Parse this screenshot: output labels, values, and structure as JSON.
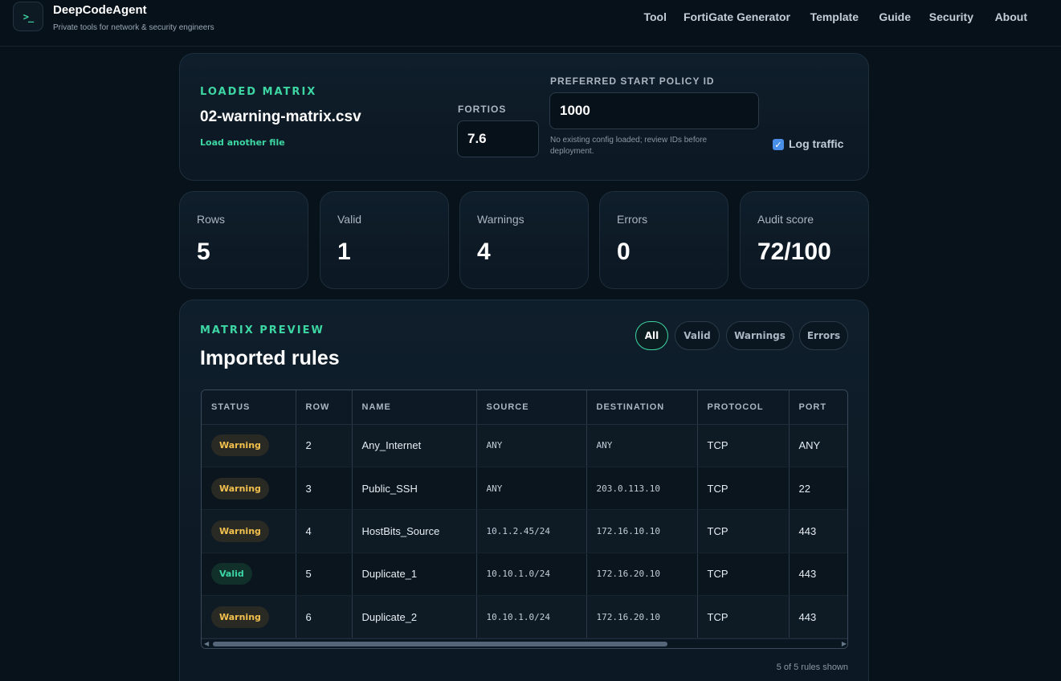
{
  "header": {
    "logo_glyph": ">_",
    "brand_name": "DeepCodeAgent",
    "tagline": "Private tools for network & security engineers",
    "nav": [
      "Tool",
      "FortiGate Generator",
      "Template",
      "Guide",
      "Security",
      "About"
    ]
  },
  "loaded": {
    "eyebrow": "LOADED MATRIX",
    "filename": "02-warning-matrix.csv",
    "load_another": "Load another file",
    "fortios_label": "FORTIOS",
    "fortios_value": "7.6",
    "policy_label": "PREFERRED START POLICY ID",
    "policy_value": "1000",
    "policy_hint": "No existing config loaded; review IDs before deployment.",
    "log_traffic_label": "Log traffic",
    "log_traffic_checked": true
  },
  "stats": [
    {
      "label": "Rows",
      "value": "5"
    },
    {
      "label": "Valid",
      "value": "1"
    },
    {
      "label": "Warnings",
      "value": "4"
    },
    {
      "label": "Errors",
      "value": "0"
    },
    {
      "label": "Audit score",
      "value": "72/100"
    }
  ],
  "preview": {
    "eyebrow": "MATRIX PREVIEW",
    "title": "Imported rules",
    "filters": [
      "All",
      "Valid",
      "Warnings",
      "Errors"
    ],
    "active_filter": "All",
    "columns": [
      "STATUS",
      "ROW",
      "NAME",
      "SOURCE",
      "DESTINATION",
      "PROTOCOL",
      "PORT"
    ],
    "rows": [
      {
        "status": "Warning",
        "row": "2",
        "name": "Any_Internet",
        "source": "ANY",
        "destination": "ANY",
        "protocol": "TCP",
        "port": "ANY"
      },
      {
        "status": "Warning",
        "row": "3",
        "name": "Public_SSH",
        "source": "ANY",
        "destination": "203.0.113.10",
        "protocol": "TCP",
        "port": "22"
      },
      {
        "status": "Warning",
        "row": "4",
        "name": "HostBits_Source",
        "source": "10.1.2.45/24",
        "destination": "172.16.10.10",
        "protocol": "TCP",
        "port": "443"
      },
      {
        "status": "Valid",
        "row": "5",
        "name": "Duplicate_1",
        "source": "10.10.1.0/24",
        "destination": "172.16.20.10",
        "protocol": "TCP",
        "port": "443"
      },
      {
        "status": "Warning",
        "row": "6",
        "name": "Duplicate_2",
        "source": "10.10.1.0/24",
        "destination": "172.16.20.10",
        "protocol": "TCP",
        "port": "443"
      }
    ],
    "footer": "5 of 5 rules shown"
  },
  "colors": {
    "accent": "#3dd6a3",
    "warning": "#f2c04d",
    "background": "#08121b",
    "checkbox": "#4a8fe7"
  },
  "icons": {
    "logo": "terminal-prompt-icon",
    "checkbox": "checkmark-icon",
    "scroll_left": "arrow-left-icon",
    "scroll_right": "arrow-right-icon"
  }
}
